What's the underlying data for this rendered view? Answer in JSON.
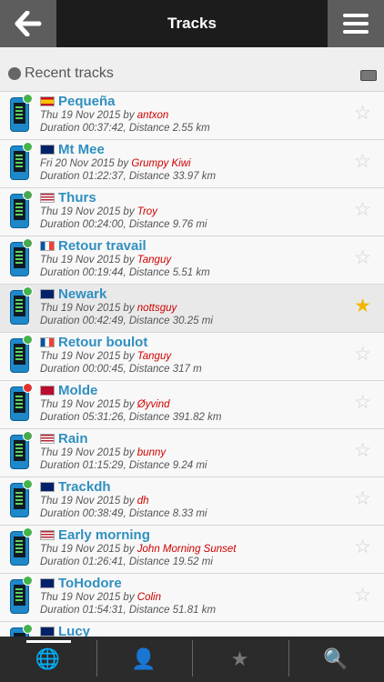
{
  "app": {
    "title": "Tracks"
  },
  "section": {
    "label": "Recent tracks"
  },
  "tracks": [
    {
      "name": "Pequeña",
      "flag": "es",
      "status": "ok",
      "date": "Thu 19 Nov 2015",
      "author": "antxon",
      "duration": "00:37:42",
      "distance": "2.55 km",
      "starred": false
    },
    {
      "name": "Mt Mee",
      "flag": "au",
      "status": "ok",
      "date": "Fri 20 Nov 2015",
      "author": "Grumpy Kiwi",
      "duration": "01:22:37",
      "distance": "33.97 km",
      "starred": false
    },
    {
      "name": "Thurs",
      "flag": "us",
      "status": "pending",
      "date": "Thu 19 Nov 2015",
      "author": "Troy",
      "duration": "00:24:00",
      "distance": "9.76 mi",
      "starred": false
    },
    {
      "name": "Retour travail",
      "flag": "fr",
      "status": "pending",
      "date": "Thu 19 Nov 2015",
      "author": "Tanguy",
      "duration": "00:19:44",
      "distance": "5.51 km",
      "starred": false
    },
    {
      "name": "Newark",
      "flag": "gb",
      "status": "ok",
      "date": "Thu 19 Nov 2015",
      "author": "nottsguy",
      "duration": "00:42:49",
      "distance": "30.25 mi",
      "starred": true
    },
    {
      "name": "Retour boulot",
      "flag": "fr",
      "status": "ok",
      "date": "Thu 19 Nov 2015",
      "author": "Tanguy",
      "duration": "00:00:45",
      "distance": "317 m",
      "starred": false
    },
    {
      "name": "Molde",
      "flag": "no",
      "status": "error",
      "date": "Thu 19 Nov 2015",
      "author": "Øyvind",
      "duration": "05:31:26",
      "distance": "391.82 km",
      "starred": false
    },
    {
      "name": "Rain",
      "flag": "us",
      "status": "pending",
      "date": "Thu 19 Nov 2015",
      "author": "bunny",
      "duration": "01:15:29",
      "distance": "9.24 mi",
      "starred": false
    },
    {
      "name": "Trackdh",
      "flag": "gb",
      "status": "ok",
      "date": "Thu 19 Nov 2015",
      "author": "dh",
      "duration": "00:38:49",
      "distance": "8.33 mi",
      "starred": false
    },
    {
      "name": "Early morning",
      "flag": "us",
      "status": "ok",
      "date": "Thu 19 Nov 2015",
      "author": "John Morning Sunset",
      "duration": "01:26:41",
      "distance": "19.52 mi",
      "starred": false
    },
    {
      "name": "ToHodore",
      "flag": "gb",
      "status": "ok",
      "date": "Thu 19 Nov 2015",
      "author": "Colin",
      "duration": "01:54:31",
      "distance": "51.81 km",
      "starred": false
    },
    {
      "name": "Lucy",
      "flag": "gb",
      "status": "ok",
      "date": "",
      "author": "",
      "duration": "",
      "distance": "",
      "starred": false
    }
  ],
  "strings": {
    "by": "by",
    "duration_prefix": "Duration",
    "distance_prefix": "Distance"
  },
  "tabs": [
    {
      "name": "globe",
      "icon": "globe-icon",
      "glyph": "🌐",
      "active": true
    },
    {
      "name": "profile",
      "icon": "person-icon",
      "glyph": "👤",
      "active": false
    },
    {
      "name": "favorites",
      "icon": "star-icon",
      "glyph": "★",
      "active": false
    },
    {
      "name": "search",
      "icon": "search-icon",
      "glyph": "🔍",
      "active": false
    }
  ],
  "colors": {
    "topbar": "#1c1c1c",
    "button": "#5d5d5d",
    "link": "#2f8fc0",
    "author": "#d00000",
    "star_on": "#f2b600"
  }
}
